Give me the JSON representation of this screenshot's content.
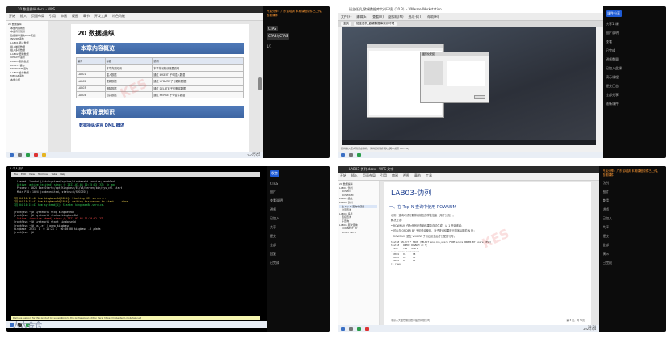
{
  "panel1": {
    "window_title": "20 数据操纵.docx - WPS",
    "ribbon": [
      "开始",
      "插入",
      "页面布局",
      "引用",
      "审阅",
      "视图",
      "章节",
      "开发工具",
      "特色功能"
    ],
    "nav": [
      "20 数据操纵",
      "本章内容概览",
      "本章背景知识",
      "数据操纵语言DML概述",
      "INSERT语句",
      "LAB01 插入数据",
      "插入单行数据",
      "插入多行数据",
      "LAB02 更新数据",
      "UPDATE语句",
      "LAB03 删除数据",
      "DELETE语句",
      "TRUNCATE语句",
      "LAB04 合并数据",
      "MERGE语句",
      "本章小结"
    ],
    "chapter_title": "20  数据操纵",
    "overview_heading": "本章内容概览",
    "table_headers": [
      "编号",
      "标题",
      "说明"
    ],
    "table_rows": [
      [
        "",
        "本章背景知识",
        "本章背景知识概要说明"
      ],
      [
        "LAB01",
        "插入数据",
        "通过 INSERT 子句插入数据"
      ],
      [
        "LAB02",
        "更新数据",
        "通过 UPDATE 子句更新数据"
      ],
      [
        "LAB03",
        "删除数据",
        "通过 DELETE 子句删除数据"
      ],
      [
        "LAB04",
        "合并数据",
        "通过 MERGE 子句合并数据"
      ]
    ],
    "background_heading": "本章背景知识",
    "sub_heading": "数据操纵语言 DML 概述",
    "right_panel": {
      "notice": "开启分享：广东省培训 本期课程课件已上传，查看课件",
      "tags": [
        "CTAS",
        "CTAS与CTAS"
      ],
      "label": "1/1"
    },
    "taskbar_time": "10:23",
    "taskbar_date": "2023/3/4"
  },
  "panel2": {
    "window_title": "班主任机_欧锡数据库实训环境（20.3）- VMware Workstation",
    "menubar": [
      "文件(F)",
      "编辑(E)",
      "查看(V)",
      "虚拟机(M)",
      "选项卡(T)",
      "帮助(H)"
    ],
    "tabs": [
      "主页",
      "班主任机_欧锡数据库实训环境"
    ],
    "dialog_title": "图形化安装",
    "status_text": "要将输入定向到该虚拟机，请将鼠标指针移入其中或按 Ctrl+G。",
    "right_panel": {
      "items": [
        "共享1 课",
        "图片说明",
        "查看",
        "已完成",
        "讲师数量",
        "已加入此课",
        "演示课程",
        "提交日志",
        "全部分享",
        "最新课件"
      ],
      "tag": "课件分享"
    }
  },
  "panel3": {
    "title": "5 个人用户",
    "menu": [
      "File",
      "Edit",
      "View",
      "Terminal",
      "Tabs",
      "Help"
    ],
    "lines": [
      {
        "t": "  Loaded: loaded (/etc/systemd/system/kingbase8d.service; enabled)",
        "c": ""
      },
      {
        "t": "  Active: active (exited) since 六 2023-03-04 10:15:43 CST; 1h ago",
        "c": "g"
      },
      {
        "t": "  Process: 1024 ExecStart=/opt/Kingbase/ES/V8/Server/bin/sys_ctl start",
        "c": ""
      },
      {
        "t": "  Main PID: 1024 (code=exited, status=0/SUCCESS)",
        "c": ""
      },
      {
        "t": "",
        "c": ""
      },
      {
        "t": "3月 04 10:15:40 kvm kingbase8d[1024]: Starting KES server...",
        "c": "y"
      },
      {
        "t": "3月 04 10:15:41 kvm kingbase8d[1024]: waiting for server to start.... done",
        "c": "y"
      },
      {
        "t": "3月 04 10:15:43 kvm systemd[1]: Started kingbase8d.service.",
        "c": "g"
      },
      {
        "t": "",
        "c": ""
      },
      {
        "t": "[root@kvm ~]# systemctl stop kingbase8d",
        "c": ""
      },
      {
        "t": "[root@kvm ~]# systemctl status kingbase8d",
        "c": ""
      },
      {
        "t": "  Active: inactive (dead) since 六 2023-03-04 11:20:02 CST",
        "c": "r"
      },
      {
        "t": "[root@kvm ~]# systemctl start kingbase8d",
        "c": ""
      },
      {
        "t": "[root@kvm ~]# ps -ef | grep kingbase",
        "c": ""
      },
      {
        "t": "kingbase  2231  1  0 11:21 ?  00:00:00 kingbase -D /data",
        "c": ""
      },
      {
        "t": "[root@kvm ~]# ",
        "c": ""
      }
    ],
    "footer_note": "Remove support for this product by subscribing to the professional edition here: https://mobaxterm.mobatek.net",
    "right_panel": {
      "tag": "发言",
      "items": [
        "CTAS",
        "图片",
        "查看说明",
        "讲师",
        "已加入",
        "共享",
        "提交",
        "全部",
        "回复",
        "已完成"
      ]
    },
    "corner_logo": "人大金仓"
  },
  "panel4": {
    "window_title": "LAB03-伪列.docx - WPS 文字",
    "ribbon": [
      "开始",
      "插入",
      "页面布局",
      "引用",
      "审阅",
      "视图",
      "章节",
      "工具"
    ],
    "nav": [
      "20 数据操纵",
      "LAB01 伪列",
      "ROWID",
      "ROWNUM",
      "LAB02 函数",
      "LAB03 伪列",
      "在 Top-N 查询中使用",
      "分页查询",
      "LAB04 多表",
      "连接查询",
      "子查询",
      "LAB05 层次查询",
      "CONNECT BY",
      "START WITH"
    ],
    "title": "LAB03-伪列",
    "heading": "一、在 Top-N 查询中使用 ROWNUM",
    "paragraphs": [
      "示例：查询考试分数排名前五的学生信息（用于分页）。",
      "解决方法：",
      "• ROWNUM 作为伪列在查询结果中自动生成，从 1 开始递增；",
      "• 可以与 ORDER BY 子句结合使用，对子查询结果进行排序后取前 N 行；",
      "• ROWNUM 是在 WHERE 子句过滤之后才分配的行号。"
    ],
    "code": "test=# SELECT * FROM (SELECT sno,cno,score FROM score ORDER BY score DESC)\ntest-#   WHERE ROWNUM <= 5;\n  sno  | cno | score\n-------+-----+-------\n 10001 | 01  |  98\n 10003 | 02  |  95\n 10002 | 01  |  92\n(3 rows)",
    "footer": "北京人大金仓信息技术股份有限公司",
    "page_info": "第 3 页，共 5 页",
    "right_panel": {
      "notice": "开启分享：广东省培训 本期课程课件已上传，查看课件",
      "items": [
        "伪列",
        "图片",
        "查看",
        "讲师",
        "已加入",
        "共享",
        "提交",
        "全部",
        "演示",
        "已完成"
      ]
    },
    "taskbar_time": "11:24",
    "taskbar_date": "2023/3/4"
  }
}
